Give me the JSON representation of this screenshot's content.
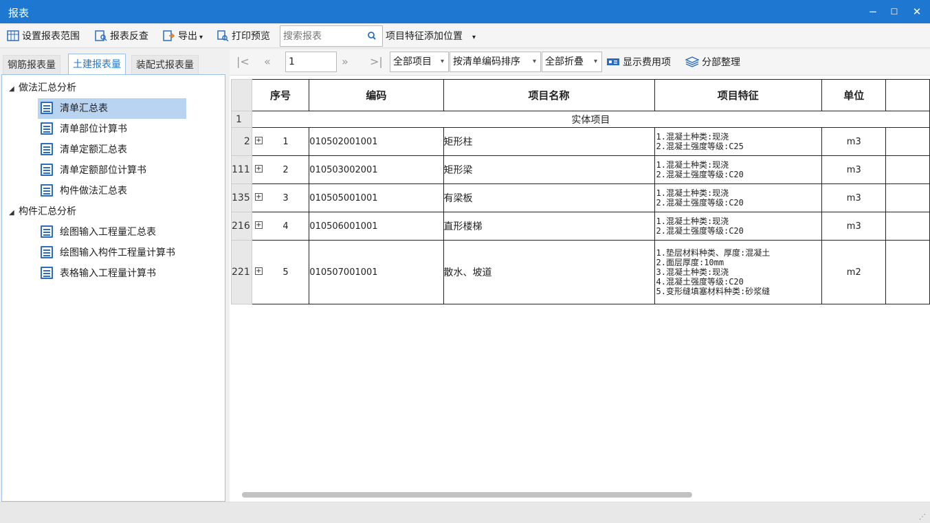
{
  "window": {
    "title": "报表",
    "controls": {
      "minimize": "−",
      "maximize": "☐",
      "close": "✕"
    }
  },
  "toolbar": {
    "set_range": "设置报表范围",
    "report_check": "报表反查",
    "export": "导出",
    "print_preview": "打印预览",
    "search_placeholder": "搜索报表",
    "feature_position": "项目特征添加位置"
  },
  "tabs": [
    {
      "label": "钢筋报表量"
    },
    {
      "label": "土建报表量"
    },
    {
      "label": "装配式报表量"
    }
  ],
  "tree": {
    "group1": {
      "label": "做法汇总分析",
      "items": [
        "清单汇总表",
        "清单部位计算书",
        "清单定额汇总表",
        "清单定额部位计算书",
        "构件做法汇总表"
      ]
    },
    "group2": {
      "label": "构件汇总分析",
      "items": [
        "绘图输入工程量汇总表",
        "绘图输入构件工程量计算书",
        "表格输入工程量计算书"
      ]
    },
    "selected": "清单汇总表"
  },
  "pager": {
    "page": "1",
    "filter": "全部项目",
    "sort": "按清单编码排序",
    "fold": "全部折叠",
    "show_fee": "显示费用项",
    "organize": "分部整理"
  },
  "table": {
    "headers": {
      "seq": "序号",
      "code": "编码",
      "name": "项目名称",
      "feature": "项目特征",
      "unit": "单位"
    },
    "section": {
      "rownum": "1",
      "label": "实体项目"
    },
    "rows": [
      {
        "rownum": "2",
        "seq": "1",
        "code": "010502001001",
        "name": "矩形柱",
        "features": [
          "1.混凝土种类:现浇",
          "2.混凝土强度等级:C25"
        ],
        "unit": "m3"
      },
      {
        "rownum": "111",
        "seq": "2",
        "code": "010503002001",
        "name": "矩形梁",
        "features": [
          "1.混凝土种类:现浇",
          "2.混凝土强度等级:C20"
        ],
        "unit": "m3"
      },
      {
        "rownum": "135",
        "seq": "3",
        "code": "010505001001",
        "name": "有梁板",
        "features": [
          "1.混凝土种类:现浇",
          "2.混凝土强度等级:C20"
        ],
        "unit": "m3"
      },
      {
        "rownum": "216",
        "seq": "4",
        "code": "010506001001",
        "name": "直形楼梯",
        "features": [
          "1.混凝土种类:现浇",
          "2.混凝土强度等级:C20"
        ],
        "unit": "m3"
      },
      {
        "rownum": "221",
        "seq": "5",
        "code": "010507001001",
        "name": "散水、坡道",
        "features": [
          "1.垫层材料种类、厚度:混凝土",
          "2.面层厚度:10mm",
          "3.混凝土种类:现浇",
          "4.混凝土强度等级:C20",
          "5.变形缝填塞材料种类:砂浆缝"
        ],
        "unit": "m2"
      }
    ]
  },
  "colors": {
    "titlebar": "#1e78d2",
    "accent": "#1e78d2",
    "selection": "#b9d4f0"
  }
}
